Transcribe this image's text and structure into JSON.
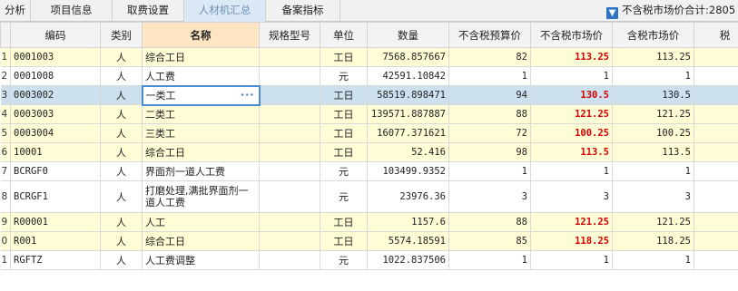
{
  "tabs": [
    {
      "label": "分析"
    },
    {
      "label": "项目信息"
    },
    {
      "label": "取费设置"
    },
    {
      "label": "人材机汇总"
    },
    {
      "label": "备案指标"
    }
  ],
  "summary_text": "不含税市场价合计:2805",
  "columns": [
    "编码",
    "类别",
    "名称",
    "规格型号",
    "单位",
    "数量",
    "不含税预算价",
    "不含税市场价",
    "含税市场价",
    "税"
  ],
  "rows": [
    {
      "rownum": "1",
      "code": "0001003",
      "type": "人",
      "name": "综合工日",
      "spec": "",
      "unit": "工日",
      "qty": "7568.857667",
      "budget": "82",
      "market": "113.25",
      "market_tax": "113.25",
      "tax": ""
    },
    {
      "rownum": "2",
      "code": "0001008",
      "type": "人",
      "name": "人工费",
      "spec": "",
      "unit": "元",
      "qty": "42591.10842",
      "budget": "1",
      "market": "1",
      "market_tax": "1",
      "tax": ""
    },
    {
      "rownum": "3",
      "code": "0003002",
      "type": "人",
      "name": "一类工",
      "spec": "",
      "unit": "工日",
      "qty": "58519.898471",
      "budget": "94",
      "market": "130.5",
      "market_tax": "130.5",
      "tax": ""
    },
    {
      "rownum": "4",
      "code": "0003003",
      "type": "人",
      "name": "二类工",
      "spec": "",
      "unit": "工日",
      "qty": "139571.887887",
      "budget": "88",
      "market": "121.25",
      "market_tax": "121.25",
      "tax": ""
    },
    {
      "rownum": "5",
      "code": "0003004",
      "type": "人",
      "name": "三类工",
      "spec": "",
      "unit": "工日",
      "qty": "16077.371621",
      "budget": "72",
      "market": "100.25",
      "market_tax": "100.25",
      "tax": ""
    },
    {
      "rownum": "6",
      "code": "10001",
      "type": "人",
      "name": "综合工日",
      "spec": "",
      "unit": "工日",
      "qty": "52.416",
      "budget": "98",
      "market": "113.5",
      "market_tax": "113.5",
      "tax": ""
    },
    {
      "rownum": "7",
      "code": "BCRGF0",
      "type": "人",
      "name": "界面剂一道人工费",
      "spec": "",
      "unit": "元",
      "qty": "103499.9352",
      "budget": "1",
      "market": "1",
      "market_tax": "1",
      "tax": ""
    },
    {
      "rownum": "8",
      "code": "BCRGF1",
      "type": "人",
      "name": "打磨处理,满批界面剂一道人工费",
      "spec": "",
      "unit": "元",
      "qty": "23976.36",
      "budget": "3",
      "market": "3",
      "market_tax": "3",
      "tax": ""
    },
    {
      "rownum": "9",
      "code": "R00001",
      "type": "人",
      "name": "人工",
      "spec": "",
      "unit": "工日",
      "qty": "1157.6",
      "budget": "88",
      "market": "121.25",
      "market_tax": "121.25",
      "tax": ""
    },
    {
      "rownum": "0",
      "code": "R001",
      "type": "人",
      "name": "综合工日",
      "spec": "",
      "unit": "工日",
      "qty": "5574.18591",
      "budget": "85",
      "market": "118.25",
      "market_tax": "118.25",
      "tax": ""
    },
    {
      "rownum": "1",
      "code": "RGFTZ",
      "type": "人",
      "name": "人工费调整",
      "spec": "",
      "unit": "元",
      "qty": "1022.837506",
      "budget": "1",
      "market": "1",
      "market_tax": "1",
      "tax": ""
    }
  ],
  "edit_button_glyph": "···",
  "colors": {
    "highlight_price": "#d40000",
    "changed_row": "#fffdd6",
    "selected_row": "#cde0ee",
    "active_tab": "#dbe9f7"
  }
}
